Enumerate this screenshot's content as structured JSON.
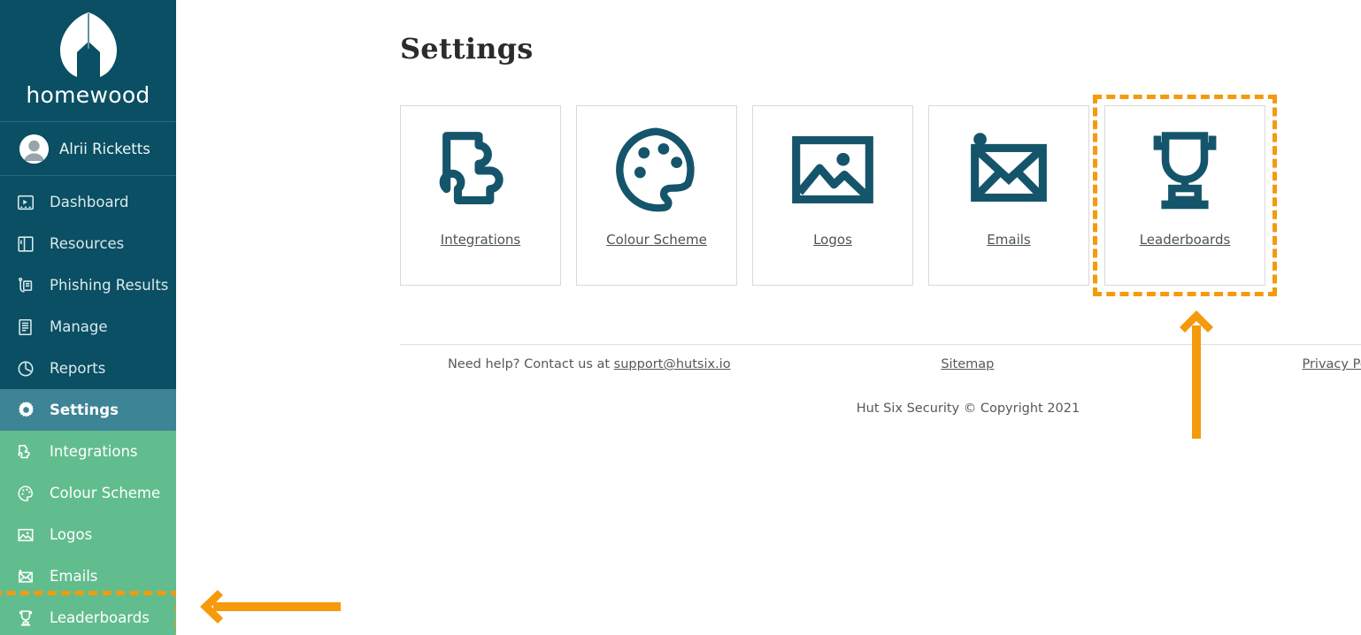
{
  "brand": {
    "name": "homewood",
    "logo_icon": "homewood-leaf-house-logo"
  },
  "user": {
    "name": "Alrii Ricketts",
    "avatar_icon": "user-avatar-icon"
  },
  "sidebar": {
    "items": [
      {
        "label": "Dashboard",
        "icon": "dashboard-icon",
        "state": "default"
      },
      {
        "label": "Resources",
        "icon": "resources-icon",
        "state": "default"
      },
      {
        "label": "Phishing Results",
        "icon": "phishing-results-icon",
        "state": "default"
      },
      {
        "label": "Manage",
        "icon": "manage-icon",
        "state": "default"
      },
      {
        "label": "Reports",
        "icon": "reports-icon",
        "state": "default"
      },
      {
        "label": "Settings",
        "icon": "gear-icon",
        "state": "active"
      },
      {
        "label": "Integrations",
        "icon": "puzzle-icon",
        "state": "sub"
      },
      {
        "label": "Colour Scheme",
        "icon": "palette-icon",
        "state": "sub"
      },
      {
        "label": "Logos",
        "icon": "image-icon",
        "state": "sub"
      },
      {
        "label": "Emails",
        "icon": "envelope-icon",
        "state": "sub"
      },
      {
        "label": "Leaderboards",
        "icon": "trophy-icon",
        "state": "sub"
      }
    ]
  },
  "main": {
    "title": "Settings",
    "cards": [
      {
        "label": "Integrations",
        "icon": "puzzle-icon",
        "highlighted": false
      },
      {
        "label": "Colour Scheme",
        "icon": "palette-icon",
        "highlighted": false
      },
      {
        "label": "Logos",
        "icon": "image-icon",
        "highlighted": false
      },
      {
        "label": "Emails",
        "icon": "envelope-icon",
        "highlighted": false
      },
      {
        "label": "Leaderboards",
        "icon": "trophy-icon",
        "highlighted": true
      }
    ]
  },
  "footer": {
    "help_prefix": "Need help? Contact us at ",
    "support_email": "support@hutsix.io",
    "sitemap": "Sitemap",
    "privacy_policy": "Privacy Policy",
    "copyright": "Hut Six Security © Copyright 2021"
  },
  "annotations": {
    "highlight_color": "#f59a0b",
    "arrow_up": "points-to-leaderboards-card",
    "arrow_left": "points-to-leaderboards-sidebar-item"
  },
  "colors": {
    "sidebar_bg": "#0a4f63",
    "sidebar_active": "#3d8496",
    "sidebar_sub": "#62bd8e",
    "icon_teal": "#15556b",
    "annotation_orange": "#f59a0b"
  }
}
